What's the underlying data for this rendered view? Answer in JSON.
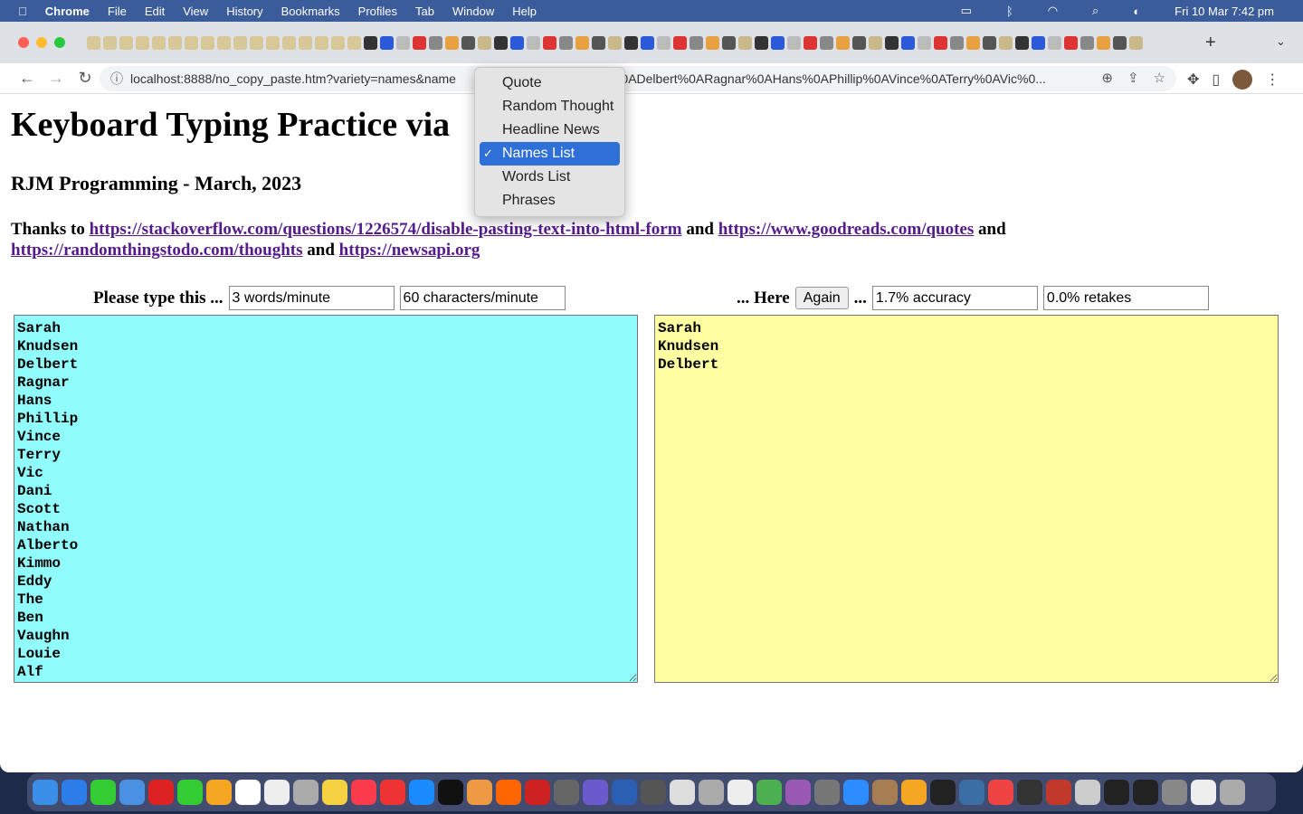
{
  "menubar": {
    "apple": "",
    "app": "Chrome",
    "items": [
      "File",
      "Edit",
      "View",
      "History",
      "Bookmarks",
      "Profiles",
      "Tab",
      "Window",
      "Help"
    ],
    "clock": "Fri 10 Mar  7:42 pm"
  },
  "browser": {
    "url": "localhost:8888/no_copy_paste.htm?variety=names&name",
    "url_tail": "%0ADelbert%0ARagnar%0AHans%0APhillip%0AVince%0ATerry%0AVic%0..."
  },
  "page": {
    "title": "Keyboard Typing Practice via",
    "subtitle": "RJM Programming - March, 2023",
    "thanks": "Thanks to",
    "and": "and",
    "links": [
      "https://stackoverflow.com/questions/1226574/disable-pasting-text-into-html-form",
      "https://www.goodreads.com/quotes",
      "https://randomthingstodo.com/thoughts",
      "https://newsapi.org"
    ],
    "prompt_label": "Please type this ...",
    "wpm": "3 words/minute",
    "cpm": "60 characters/minute",
    "here_label": "... Here",
    "again": "Again",
    "ellipsis": "...",
    "accuracy": "1.7% accuracy",
    "retakes": "0.0% retakes",
    "source_text": "Sarah\nKnudsen\nDelbert\nRagnar\nHans\nPhillip\nVince\nTerry\nVic\nDani\nScott\nNathan\nAlberto\nKimmo\nEddy\nThe\nBen\nVaughn\nLouie\nAlf",
    "typed_text": "Sarah\nKnudsen\nDelbert",
    "source_bg": "#90fcfc",
    "typed_bg": "#fffea0"
  },
  "dropdown": {
    "options": [
      "Quote",
      "Random Thought",
      "Headline News",
      "Names List",
      "Words List",
      "Phrases"
    ],
    "selected": "Names List",
    "check": "✓"
  }
}
